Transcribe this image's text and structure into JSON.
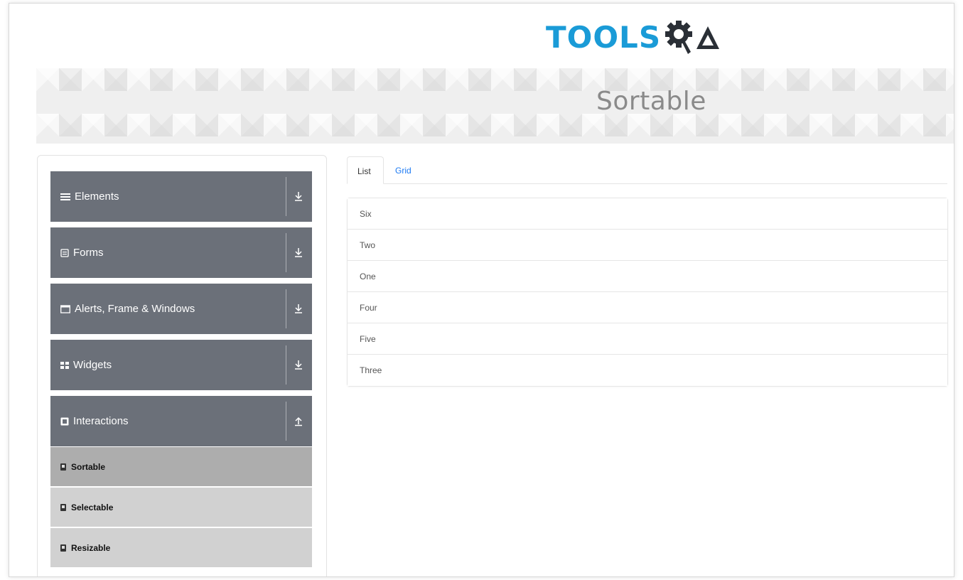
{
  "logo": {
    "text": "TOOLS",
    "text_color": "#1a9bd7",
    "gear_color": "#2a2f36",
    "a_color": "#2a2f36"
  },
  "banner": {
    "title": "Sortable"
  },
  "sidebar": {
    "groups": [
      {
        "label": "Elements",
        "icon": "hamburger-icon",
        "expanded": false
      },
      {
        "label": "Forms",
        "icon": "form-icon",
        "expanded": false
      },
      {
        "label": "Alerts, Frame & Windows",
        "icon": "window-icon",
        "expanded": false
      },
      {
        "label": "Widgets",
        "icon": "grid-icon",
        "expanded": false
      },
      {
        "label": "Interactions",
        "icon": "interaction-icon",
        "expanded": true
      }
    ],
    "sub_items": [
      {
        "label": "Sortable",
        "active": true
      },
      {
        "label": "Selectable",
        "active": false
      },
      {
        "label": "Resizable",
        "active": false
      }
    ],
    "group_bg": "#6b7079",
    "sub_active_bg": "#adadad",
    "sub_bg": "#d1d1d1"
  },
  "tabs": [
    {
      "label": "List",
      "active": true
    },
    {
      "label": "Grid",
      "active": false
    }
  ],
  "list": {
    "items": [
      "Six",
      "Two",
      "One",
      "Four",
      "Five",
      "Three"
    ]
  },
  "colors": {
    "link": "#1d7af3"
  }
}
